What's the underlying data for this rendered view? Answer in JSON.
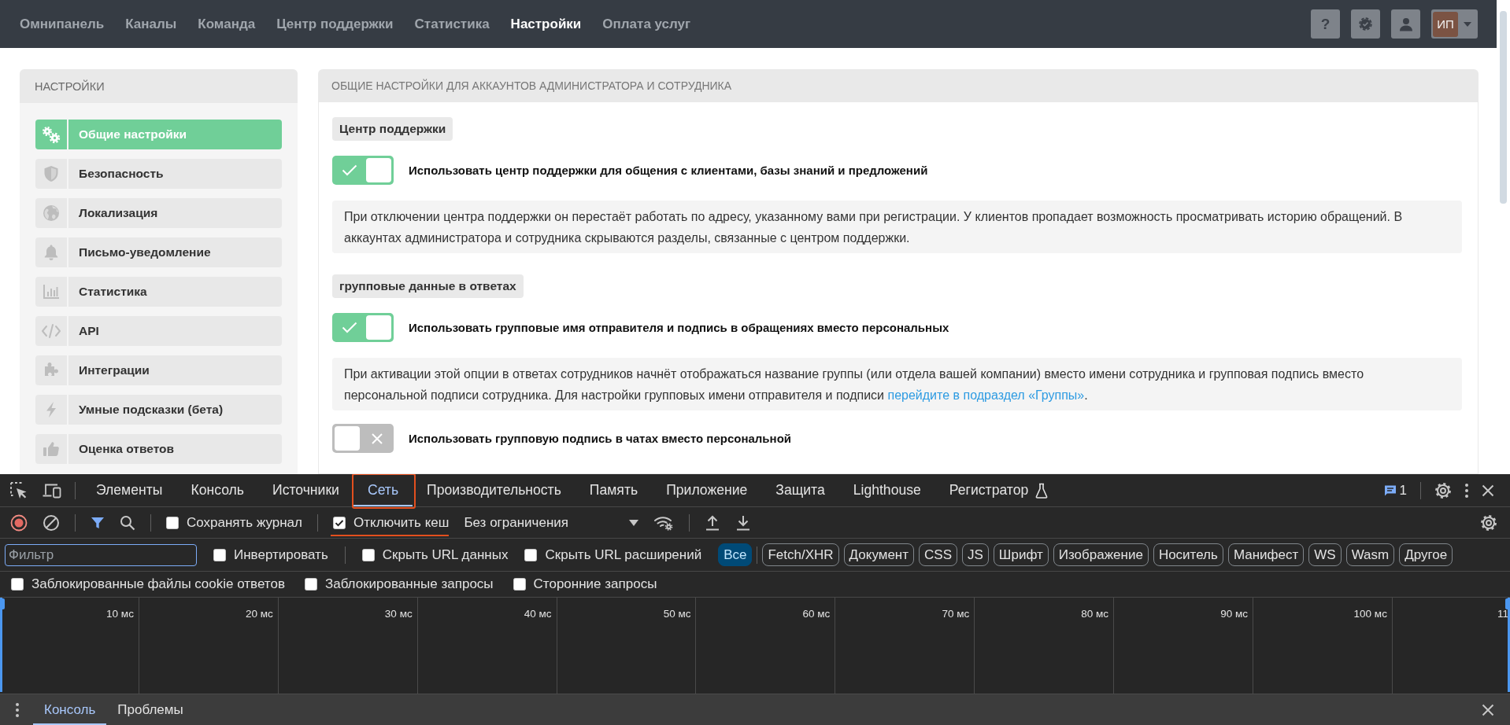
{
  "nav": {
    "items": [
      {
        "label": "Омнипанель",
        "selected": false
      },
      {
        "label": "Каналы",
        "selected": false
      },
      {
        "label": "Команда",
        "selected": false
      },
      {
        "label": "Центр поддержки",
        "selected": false
      },
      {
        "label": "Статистика",
        "selected": false
      },
      {
        "label": "Настройки",
        "selected": true
      },
      {
        "label": "Оплата услуг",
        "selected": false
      }
    ],
    "help": "?",
    "avatar": "ИП"
  },
  "sidebar": {
    "title": "НАСТРОЙКИ",
    "items": [
      {
        "label": "Общие настройки",
        "selected": true
      },
      {
        "label": "Безопасность",
        "selected": false
      },
      {
        "label": "Локализация",
        "selected": false
      },
      {
        "label": "Письмо-уведомление",
        "selected": false
      },
      {
        "label": "Статистика",
        "selected": false
      },
      {
        "label": "API",
        "selected": false
      },
      {
        "label": "Интеграции",
        "selected": false
      },
      {
        "label": "Умные подсказки (бета)",
        "selected": false
      },
      {
        "label": "Оценка ответов",
        "selected": false
      }
    ]
  },
  "panel": {
    "title": "ОБЩИЕ НАСТРОЙКИ ДЛЯ АККАУНТОВ АДМИНИСТРАТОРА И СОТРУДНИКА",
    "blocks": [
      {
        "kind": "heading",
        "text": "Центр поддержки"
      },
      {
        "kind": "toggle",
        "label": "Использовать центр поддержки для общения с клиентами, базы знаний и предложений",
        "on": true
      },
      {
        "kind": "note",
        "text": "При отключении центра поддержки он перестаёт работать по адресу, указанному вами при регистрации. У клиентов пропадает возможность просматривать историю обращений. В аккаунтах администратора и сотрудника скрываются разделы, связанные с центром поддержки."
      },
      {
        "kind": "heading",
        "text": "групповые данные в ответах"
      },
      {
        "kind": "toggle",
        "label": "Использовать групповые имя отправителя и подпись в обращениях вместо персональных",
        "on": true
      },
      {
        "kind": "note",
        "text": "При активации этой опции в ответах сотрудников начнёт отображаться название группы (или отдела вашей компании) вместо имени сотрудника и групповая подпись вместо персональной подписи сотрудника. Для настройки групповых имени отправителя и подписи ",
        "link": "перейдите в подраздел «Группы»",
        "tail": "."
      },
      {
        "kind": "toggle",
        "label": "Использовать групповую подпись в чатах вместо персональной",
        "on": false
      }
    ]
  },
  "devtools": {
    "tabs": [
      {
        "label": "Элементы",
        "selected": false,
        "highlighted": false,
        "experimental": false
      },
      {
        "label": "Консоль",
        "selected": false,
        "highlighted": false,
        "experimental": false
      },
      {
        "label": "Источники",
        "selected": false,
        "highlighted": false,
        "experimental": false
      },
      {
        "label": "Сеть",
        "selected": true,
        "highlighted": true,
        "experimental": false
      },
      {
        "label": "Производительность",
        "selected": false,
        "highlighted": false,
        "experimental": false
      },
      {
        "label": "Память",
        "selected": false,
        "highlighted": false,
        "experimental": false
      },
      {
        "label": "Приложение",
        "selected": false,
        "highlighted": false,
        "experimental": false
      },
      {
        "label": "Защита",
        "selected": false,
        "highlighted": false,
        "experimental": false
      },
      {
        "label": "Lighthouse",
        "selected": false,
        "highlighted": false,
        "experimental": false
      },
      {
        "label": "Регистратор",
        "selected": false,
        "highlighted": false,
        "experimental": true
      }
    ],
    "issues": "1",
    "network_toolbar": {
      "options": [
        {
          "label": "Сохранять журнал",
          "checked": false,
          "highlighted": false
        },
        {
          "label": "Отключить кеш",
          "checked": true,
          "highlighted": true
        }
      ],
      "throttling": "Без ограничения"
    },
    "filter": {
      "placeholder": "Фильтр",
      "options": [
        {
          "label": "Инвертировать",
          "checked": false
        },
        {
          "label": "Скрыть URL данных",
          "checked": false
        },
        {
          "label": "Скрыть URL расширений",
          "checked": false
        }
      ],
      "types": [
        {
          "label": "Все",
          "selected": true
        },
        {
          "label": "Fetch/XHR",
          "selected": false
        },
        {
          "label": "Документ",
          "selected": false
        },
        {
          "label": "CSS",
          "selected": false
        },
        {
          "label": "JS",
          "selected": false
        },
        {
          "label": "Шрифт",
          "selected": false
        },
        {
          "label": "Изображение",
          "selected": false
        },
        {
          "label": "Носитель",
          "selected": false
        },
        {
          "label": "Манифест",
          "selected": false
        },
        {
          "label": "WS",
          "selected": false
        },
        {
          "label": "Wasm",
          "selected": false
        },
        {
          "label": "Другое",
          "selected": false
        }
      ]
    },
    "more_options": [
      {
        "label": "Заблокированные файлы cookie ответов",
        "checked": false
      },
      {
        "label": "Заблокированные запросы",
        "checked": false
      },
      {
        "label": "Сторонние запросы",
        "checked": false
      }
    ],
    "timeline_ticks": [
      "10 мс",
      "20 мс",
      "30 мс",
      "40 мс",
      "50 мс",
      "60 мс",
      "70 мс",
      "80 мс",
      "90 мс",
      "100 мс",
      "11"
    ],
    "drawer_tabs": [
      {
        "label": "Консоль",
        "selected": true
      },
      {
        "label": "Проблемы",
        "selected": false
      }
    ]
  }
}
